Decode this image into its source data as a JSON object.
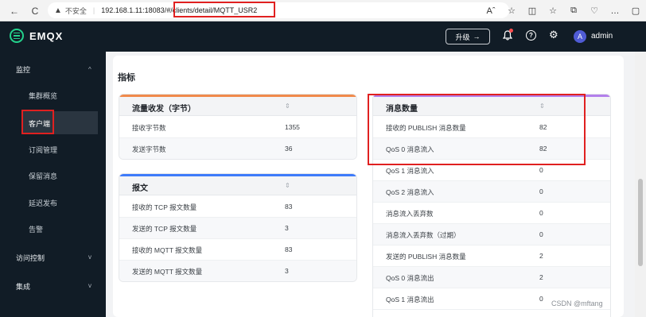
{
  "browser": {
    "back": "←",
    "refresh": "C",
    "not_secure": "不安全",
    "url_host": "192.168.1.11:18083/",
    "url_path": "#/clients/detail/MQTT_USR2",
    "chrome_icons": [
      "Aˆ",
      "☆",
      "◫",
      "☆",
      "⧉",
      "♡",
      "…",
      "▢"
    ]
  },
  "header": {
    "logo": "EMQX",
    "upgrade": "升级",
    "upgrade_arrow": "→",
    "bell": "🔔",
    "help": "?",
    "settings": "⚙",
    "avatar_letter": "A",
    "user": "admin"
  },
  "sidebar": {
    "groups": [
      {
        "label": "监控",
        "chevron": "^"
      },
      {
        "label": "访问控制",
        "chevron": "v"
      },
      {
        "label": "集成",
        "chevron": "v"
      }
    ],
    "items": [
      "集群概览",
      "客户端",
      "订阅管理",
      "保留消息",
      "延迟发布",
      "告警"
    ]
  },
  "main": {
    "section_title": "指标",
    "traffic": {
      "title": "流量收发（字节）",
      "sort": "⇕",
      "accent": "#f08a4b",
      "rows": [
        {
          "k": "接收字节数",
          "v": "1355"
        },
        {
          "k": "发送字节数",
          "v": "36"
        }
      ]
    },
    "packets": {
      "title": "报文",
      "sort": "⇕",
      "accent": "#3e7bfa",
      "rows": [
        {
          "k": "接收的 TCP 报文数量",
          "v": "83"
        },
        {
          "k": "发送的 TCP 报文数量",
          "v": "3"
        },
        {
          "k": "接收的 MQTT 报文数量",
          "v": "83"
        },
        {
          "k": "发送的 MQTT 报文数量",
          "v": "3"
        }
      ]
    },
    "messages": {
      "title": "消息数量",
      "sort": "⇕",
      "accent": "#b37feb",
      "rows": [
        {
          "k": "接收的 PUBLISH 消息数量",
          "v": "82"
        },
        {
          "k": "QoS 0 消息流入",
          "v": "82"
        },
        {
          "k": "QoS 1 消息流入",
          "v": "0"
        },
        {
          "k": "QoS 2 消息流入",
          "v": "0"
        },
        {
          "k": "消息流入丢弃数",
          "v": "0"
        },
        {
          "k": "消息流入丢弃数（过期）",
          "v": "0"
        },
        {
          "k": "发送的 PUBLISH 消息数量",
          "v": "2"
        },
        {
          "k": "QoS 0 消息流出",
          "v": "2"
        },
        {
          "k": "QoS 1 消息流出",
          "v": "0"
        }
      ]
    }
  },
  "watermark": "CSDN @mftang"
}
